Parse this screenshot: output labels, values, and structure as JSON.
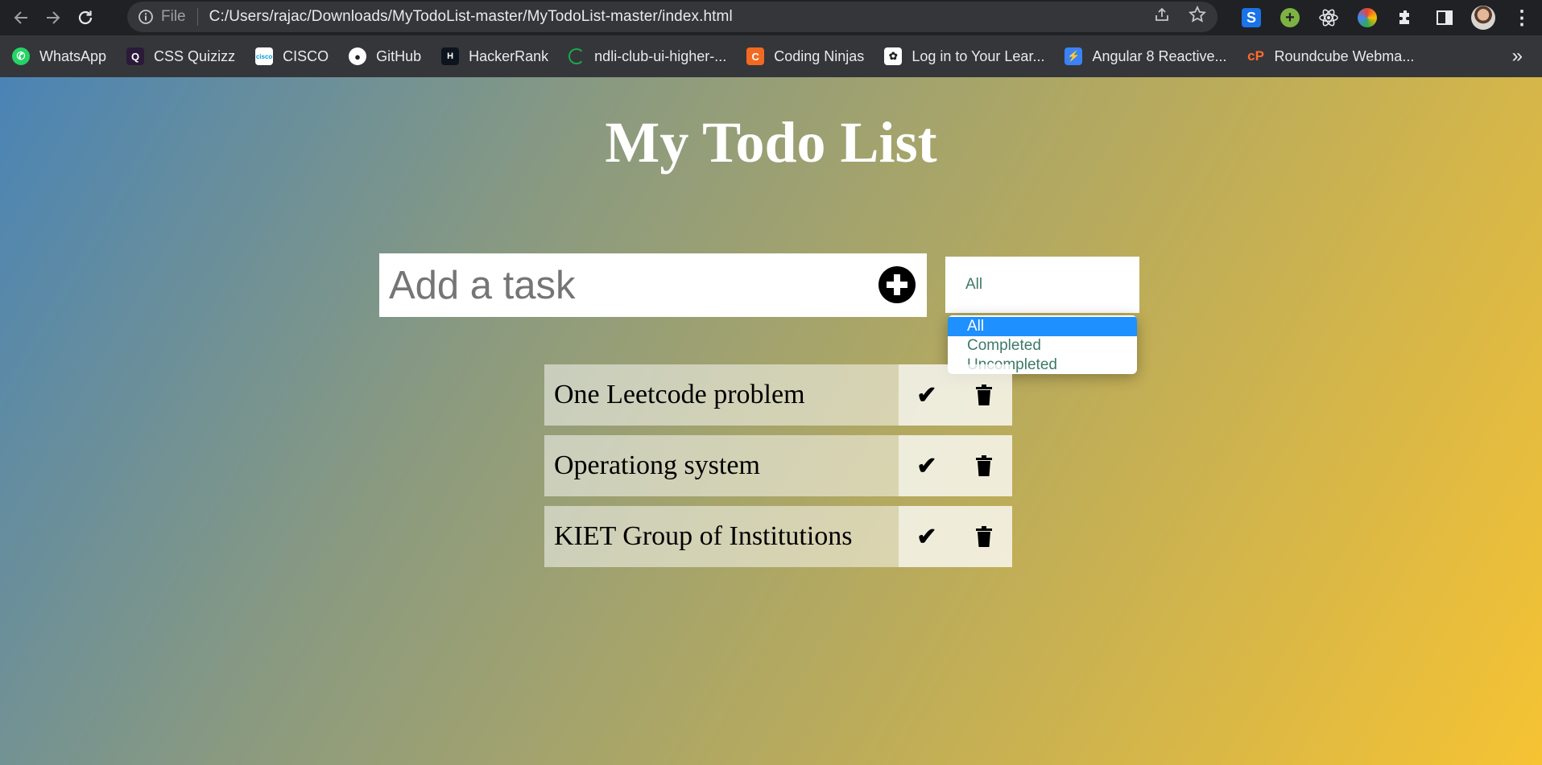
{
  "browser": {
    "omnibox": {
      "scheme_label": "File",
      "url": "C:/Users/rajac/Downloads/MyTodoList-master/MyTodoList-master/index.html"
    },
    "bookmarks": [
      {
        "label": "WhatsApp",
        "icon": "whatsapp-icon",
        "color": "#25d366"
      },
      {
        "label": "CSS  Quizizz",
        "icon": "quizizz-icon",
        "color": "#8854c0"
      },
      {
        "label": "CISCO",
        "icon": "cisco-icon",
        "color": "#049fd9"
      },
      {
        "label": "GitHub",
        "icon": "github-icon",
        "color": "#ffffff"
      },
      {
        "label": "HackerRank",
        "icon": "hackerrank-icon",
        "color": "#1ba94c"
      },
      {
        "label": "ndli-club-ui-higher-...",
        "icon": "loading-ring-icon",
        "color": "#1ba94c"
      },
      {
        "label": "Coding Ninjas",
        "icon": "coding-ninjas-icon",
        "color": "#f26a21"
      },
      {
        "label": "Log in to Your Lear...",
        "icon": "learning-icon",
        "color": "#ffffff"
      },
      {
        "label": "Angular 8 Reactive...",
        "icon": "bolt-icon",
        "color": "#3b82f6"
      },
      {
        "label": "Roundcube Webma...",
        "icon": "cpanel-icon",
        "color": "#ff6c2c"
      }
    ],
    "more_label": "»"
  },
  "page": {
    "title": "My Todo List",
    "task_input": {
      "placeholder": "Add a task",
      "value": ""
    },
    "filter": {
      "selected": "All",
      "options": [
        "All",
        "Completed",
        "Uncompleted"
      ]
    },
    "todos": [
      {
        "text": "One Leetcode problem"
      },
      {
        "text": "Operationg system"
      },
      {
        "text": "KIET Group of Institutions"
      }
    ]
  },
  "colors": {
    "gradient_start": "#4a84b5",
    "gradient_end": "#f6c333",
    "select_text": "#3d7a68",
    "option_highlight": "#1e90ff"
  }
}
